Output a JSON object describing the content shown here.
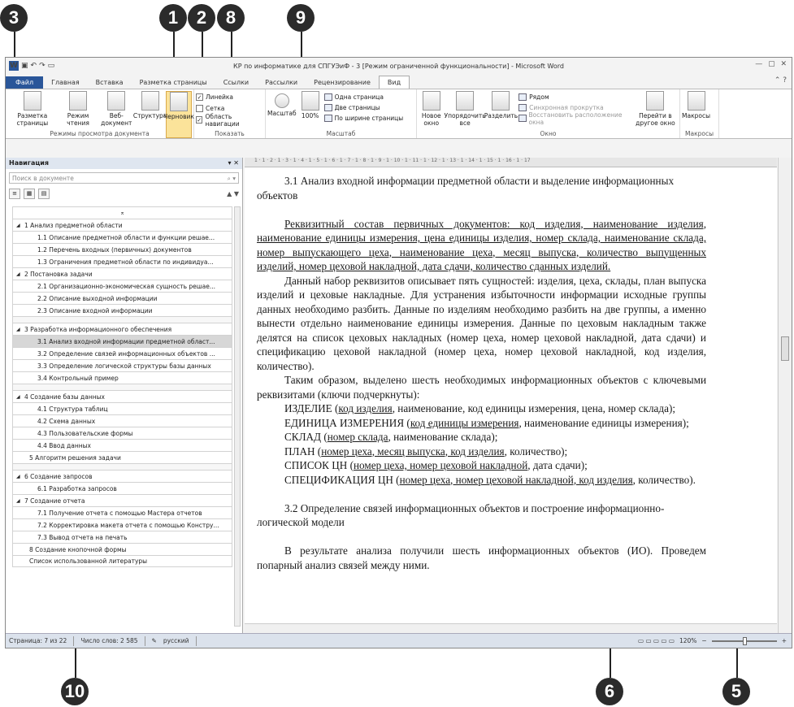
{
  "callouts": [
    "1",
    "2",
    "8",
    "3",
    "9",
    "10",
    "6",
    "5"
  ],
  "window": {
    "title": "КР по информатике для СПГУЭиФ - 3 [Режим ограниченной функциональности] - Microsoft Word",
    "app_icon": "W",
    "qat": [
      "save-icon",
      "undo-icon",
      "redo-icon",
      "open-icon"
    ]
  },
  "tabs": [
    "Файл",
    "Главная",
    "Вставка",
    "Разметка страницы",
    "Ссылки",
    "Рассылки",
    "Рецензирование",
    "Вид"
  ],
  "ribbon": {
    "views": {
      "label": "Режимы просмотра документа",
      "buttons": [
        "Разметка страницы",
        "Режим чтения",
        "Веб-документ",
        "Структура",
        "Черновик"
      ]
    },
    "show": {
      "label": "Показать",
      "checks": [
        {
          "label": "Линейка",
          "checked": true
        },
        {
          "label": "Сетка",
          "checked": false
        },
        {
          "label": "Область навигации",
          "checked": true
        }
      ]
    },
    "zoom": {
      "label": "Масштаб",
      "buttons": [
        "Масштаб",
        "100%"
      ],
      "small": [
        "Одна страница",
        "Две страницы",
        "По ширине страницы"
      ]
    },
    "window": {
      "label": "Окно",
      "buttons": [
        "Новое окно",
        "Упорядочить все",
        "Разделить"
      ],
      "small": [
        "Рядом",
        "Синхронная прокрутка",
        "Восстановить расположение окна"
      ],
      "switch": "Перейти в другое окно"
    },
    "macros": {
      "label": "Макросы",
      "button": "Макросы"
    }
  },
  "nav": {
    "title": "Навигация",
    "search_placeholder": "Поиск в документе",
    "items": [
      {
        "level": "h1",
        "text": "1 Анализ предметной области"
      },
      {
        "level": "h2",
        "text": "1.1 Описание предметной области и функции решае..."
      },
      {
        "level": "h2",
        "text": "1.2 Перечень входных (первичных) документов"
      },
      {
        "level": "h2",
        "text": "1.3 Ограничения предметной области по индивидуа..."
      },
      {
        "level": "h1",
        "text": "2 Постановка задачи"
      },
      {
        "level": "h2",
        "text": "2.1 Организационно-экономическая сущность решае..."
      },
      {
        "level": "h2",
        "text": "2.2 Описание выходной информации"
      },
      {
        "level": "h2",
        "text": "2.3 Описание входной информации"
      },
      {
        "level": "h1",
        "text": "3 Разработка информационного обеспечения"
      },
      {
        "level": "h2",
        "text": "3.1 Анализ входной информации предметной област..."
      },
      {
        "level": "h2",
        "text": "3.2 Определение связей информационных объектов ..."
      },
      {
        "level": "h2",
        "text": "3.3 Определение логической структуры базы данных"
      },
      {
        "level": "h2",
        "text": "3.4 Контрольный пример"
      },
      {
        "level": "h1",
        "text": "4 Создание базы данных"
      },
      {
        "level": "h2",
        "text": "4.1 Структура таблиц"
      },
      {
        "level": "h2",
        "text": "4.2 Схема данных"
      },
      {
        "level": "h2",
        "text": "4.3 Пользовательские формы"
      },
      {
        "level": "h2",
        "text": "4.4 Ввод данных"
      },
      {
        "level": "plain",
        "text": "5 Алгоритм решения задачи"
      },
      {
        "level": "h1",
        "text": "6 Создание запросов"
      },
      {
        "level": "h2",
        "text": "6.1 Разработка запросов"
      },
      {
        "level": "h1",
        "text": "7 Создание отчета"
      },
      {
        "level": "h2",
        "text": "7.1 Получение отчета с помощью Мастера отчетов"
      },
      {
        "level": "h2",
        "text": "7.2 Корректировка макета отчета с помощью Констру..."
      },
      {
        "level": "h2",
        "text": "7.3 Вывод отчета на печать"
      },
      {
        "level": "plain",
        "text": "8 Создание кнопочной формы"
      },
      {
        "level": "plain",
        "text": "Список использованной литературы"
      }
    ]
  },
  "ruler": "1 · 1 · 2 · 1 · 3 · 1 · 4 · 1 · 5 · 1 · 6 · 1 · 7 · 1 · 8 · 1 · 9 · 1 · 10 · 1 · 11 · 1 · 12 · 1 · 13 · 1 · 14 · 1 · 15 · 1 · 16 · 1 · 17",
  "document": {
    "heading1": "3.1 Анализ входной информации предметной области и выделение информационных объектов",
    "p1": "Реквизитный состав первичных документов: код изделия, наименование изделия, наименование единицы измерения, цена единицы изделия, номер склада, наименование склада, номер выпускающего цеха, наименование цеха, месяц выпуска, количество выпущенных изделий, номер цеховой накладной, дата сдачи, количество сданных изделий.",
    "p2": "Данный набор реквизитов описывает пять сущностей: изделия, цеха, склады, план выпуска изделий и цеховые накладные. Для устранения избыточности информации исходные группы данных необходимо разбить. Данные по изделиям необходимо разбить на две группы, а именно вынести отдельно наименование единицы измерения. Данные по цеховым накладным также делятся на список цеховых накладных (номер цеха, номер цеховой накладной, дата сдачи) и спецификацию цеховой накладной (номер цеха, номер цеховой накладной, код изделия, количество).",
    "p3": "Таким образом, выделено шесть необходимых информационных объектов с ключевыми реквизитами (ключи подчеркнуты):",
    "e1": {
      "name": "ИЗДЕЛИЕ (",
      "key": "код изделия",
      "rest": ", наименование, код единицы измерения, цена, номер склада);"
    },
    "e2": {
      "name": "ЕДИНИЦА ИЗМЕРЕНИЯ (",
      "key": "код единицы измерения",
      "rest": ", наименование единицы измерения);"
    },
    "e3": {
      "name": "СКЛАД (",
      "key": "номер склада",
      "rest": ", наименование склада);"
    },
    "e4": {
      "name": "ПЛАН (",
      "key": "номер цеха, месяц выпуска, код изделия",
      "rest": ", количество);"
    },
    "e5": {
      "name": "СПИСОК ЦН (",
      "key": "номер цеха, номер цеховой накладной",
      "rest": ", дата сдачи);"
    },
    "e6": {
      "name": "СПЕЦИФИКАЦИЯ ЦН (",
      "key": "номер цеха, номер цеховой накладной, код изделия",
      "rest": ", количество)."
    },
    "heading2": "3.2 Определение связей информационных объектов и построение информационно-логической модели",
    "p4": "В результате анализа получили шесть информационных объектов (ИО). Проведем попарный анализ связей между ними."
  },
  "status": {
    "page": "Страница: 7 из 22",
    "words": "Число слов: 2 585",
    "lang": "русский",
    "zoom": "120%",
    "zoom_minus": "−",
    "zoom_plus": "+"
  }
}
